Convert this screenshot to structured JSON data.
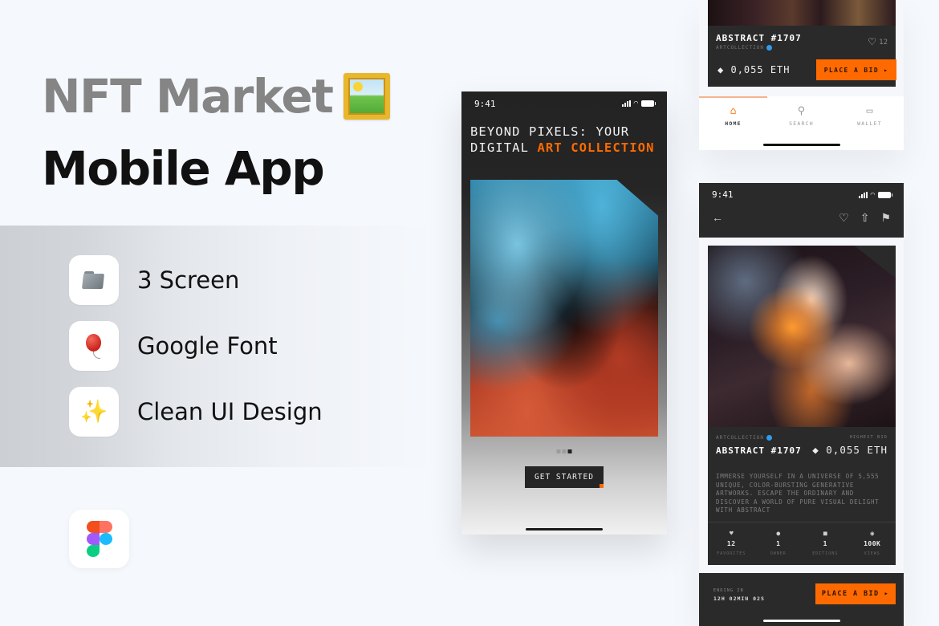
{
  "promo": {
    "title_line1": "NFT Market",
    "title_emoji": "framed-picture",
    "title_line2": "Mobile App",
    "features": [
      {
        "icon": "folder-icon",
        "label": "3 Screen"
      },
      {
        "icon": "balloon-icon",
        "label": "Google Font"
      },
      {
        "icon": "sparkles-icon",
        "label": "Clean UI Design"
      }
    ],
    "tool_badge": "figma-logo"
  },
  "colors": {
    "accent": "#ff6a00",
    "dark_surface": "#2a2a2a",
    "background": "#f5f8fc",
    "verified": "#2d9cf0"
  },
  "onboarding": {
    "time": "9:41",
    "headline_part1": "BEYOND PIXELS: YOUR DIGITAL ",
    "headline_accent": "ART COLLECTION",
    "carousel": {
      "total": 3,
      "active_index": 3
    },
    "cta_label": "GET STARTED"
  },
  "home": {
    "card": {
      "title": "ABSTRACT #1707",
      "collection": "ARTCOLLECTION",
      "likes": "12",
      "price": "0,055 ETH",
      "bid_label": "PLACE A BID"
    },
    "tabs": [
      {
        "label": "HOME",
        "icon": "home-icon",
        "active": true
      },
      {
        "label": "SEARCH",
        "icon": "search-icon",
        "active": false
      },
      {
        "label": "WALLET",
        "icon": "wallet-icon",
        "active": false
      }
    ]
  },
  "detail": {
    "time": "9:41",
    "collection": "ARTCOLLECTION",
    "title": "ABSTRACT #1707",
    "highest_bid_label": "HIGHEST BID",
    "price": "0,055 ETH",
    "description": "IMMERSE YOURSELF IN A UNIVERSE OF 5,555 UNIQUE, COLOR-BURSTING GENERATIVE ARTWORKS. ESCAPE THE ORDINARY AND DISCOVER A WORLD OF PURE VISUAL DELIGHT WITH ABSTRACT",
    "stats": [
      {
        "icon": "heart-icon",
        "value": "12",
        "label": "FAVORITES"
      },
      {
        "icon": "person-icon",
        "value": "1",
        "label": "OWNER"
      },
      {
        "icon": "image-icon",
        "value": "1",
        "label": "EDITIONS"
      },
      {
        "icon": "eye-icon",
        "value": "100K",
        "label": "VIEWS"
      }
    ],
    "ending_label": "ENDING IN",
    "ending_value": "12H 02MIN 02S",
    "bid_label": "PLACE A BID"
  }
}
